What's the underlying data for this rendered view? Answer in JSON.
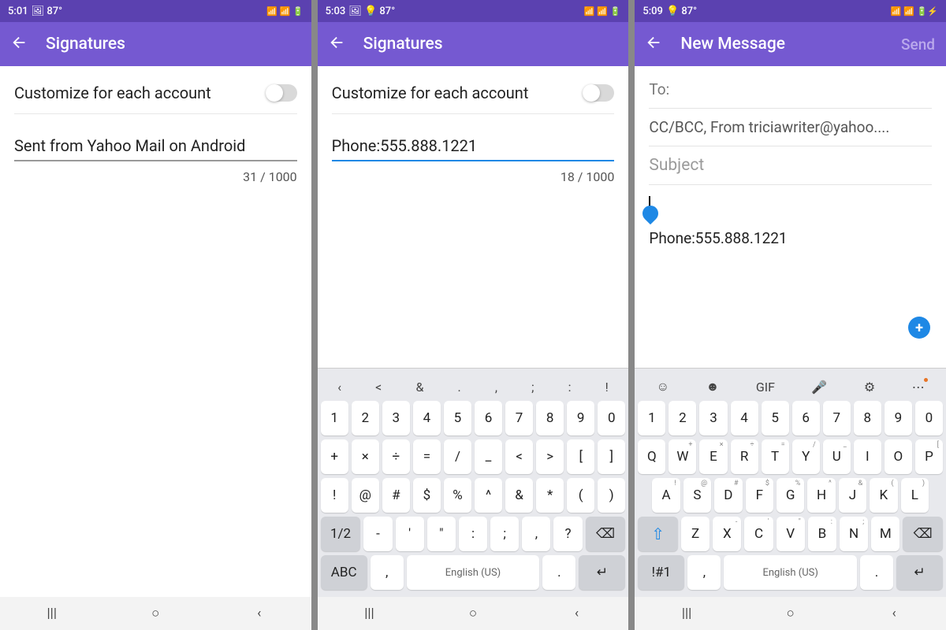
{
  "colors": {
    "statusbar": "#5b41b0",
    "appbar": "#7559d1",
    "accent_blue": "#1e88e5"
  },
  "panes": [
    {
      "status": {
        "time": "5:01",
        "icons_left": "🖼 87°",
        "icons_right": "📶 📶 🔋"
      },
      "appbar": {
        "title": "Signatures",
        "send_visible": false
      },
      "customize": {
        "label": "Customize for each account",
        "checked": false
      },
      "signature": {
        "value": "Sent from Yahoo Mail on Android",
        "focused": false,
        "counter": "31 / 1000"
      }
    },
    {
      "status": {
        "time": "5:03",
        "icons_left": "🖼 💡 87°",
        "icons_right": "📶 📶 🔋"
      },
      "appbar": {
        "title": "Signatures",
        "send_visible": false
      },
      "customize": {
        "label": "Customize for each account",
        "checked": false
      },
      "signature": {
        "value": "Phone:555.888.1221",
        "focused": true,
        "counter": "18 / 1000"
      },
      "keyboard_type": "symbols"
    },
    {
      "status": {
        "time": "5:09",
        "icons_left": "💡 87°",
        "icons_right": "📶 📶 🔋⚡"
      },
      "appbar": {
        "title": "New Message",
        "send_visible": true,
        "send_label": "Send"
      },
      "compose": {
        "to_label": "To:",
        "ccbcc": "CC/BCC, From triciawriter@yahoo....",
        "subject_placeholder": "Subject",
        "body": "Phone:555.888.1221"
      },
      "keyboard_type": "qwerty"
    }
  ],
  "keyboards": {
    "symbols": {
      "toolbar": [
        "‹",
        "<",
        "&",
        ".",
        ",",
        ";",
        ":",
        "!"
      ],
      "row1": [
        "1",
        "2",
        "3",
        "4",
        "5",
        "6",
        "7",
        "8",
        "9",
        "0"
      ],
      "row2": [
        "+",
        "×",
        "÷",
        "=",
        "/",
        "_",
        "<",
        ">",
        "[",
        "]"
      ],
      "row3": [
        "!",
        "@",
        "#",
        "$",
        "%",
        "^",
        "&",
        "*",
        "(",
        ")"
      ],
      "row4_left": "1/2",
      "row4_mid": [
        "-",
        "'",
        "\"",
        ":",
        ";",
        ",",
        "?"
      ],
      "row4_right": "⌫",
      "row5": {
        "mode": "ABC",
        "comma": ",",
        "space": "English (US)",
        "period": ".",
        "enter": "↵"
      }
    },
    "qwerty": {
      "toolbar_icons": [
        "emoji-icon",
        "sticker-icon",
        "gif-icon",
        "mic-icon",
        "gear-icon",
        "more-icon"
      ],
      "toolbar_labels": [
        "☺",
        "☻",
        "GIF",
        "🎤",
        "⚙",
        "⋯"
      ],
      "row1": [
        "1",
        "2",
        "3",
        "4",
        "5",
        "6",
        "7",
        "8",
        "9",
        "0"
      ],
      "row2": [
        "Q",
        "W",
        "E",
        "R",
        "T",
        "Y",
        "U",
        "I",
        "O",
        "P"
      ],
      "row2_sup": [
        "",
        "+",
        "×",
        "÷",
        "=",
        "/",
        "_",
        "",
        "",
        "[",
        "]"
      ],
      "row3": [
        "A",
        "S",
        "D",
        "F",
        "G",
        "H",
        "J",
        "K",
        "L"
      ],
      "row3_sup": [
        "!",
        "@",
        "#",
        "$",
        "%",
        "^",
        "&",
        "(",
        ")"
      ],
      "row4_left": "⇧",
      "row4_mid": [
        "Z",
        "X",
        "C",
        "V",
        "B",
        "N",
        "M"
      ],
      "row4_sup": [
        "",
        "-",
        "'",
        "\"",
        ":",
        ";",
        "",
        "?"
      ],
      "row4_right": "⌫",
      "row5": {
        "mode": "!#1",
        "comma": ",",
        "space": "English (US)",
        "period": ".",
        "enter": "↵"
      }
    }
  },
  "nav": {
    "recent": "|||",
    "home": "○",
    "back": "‹"
  }
}
